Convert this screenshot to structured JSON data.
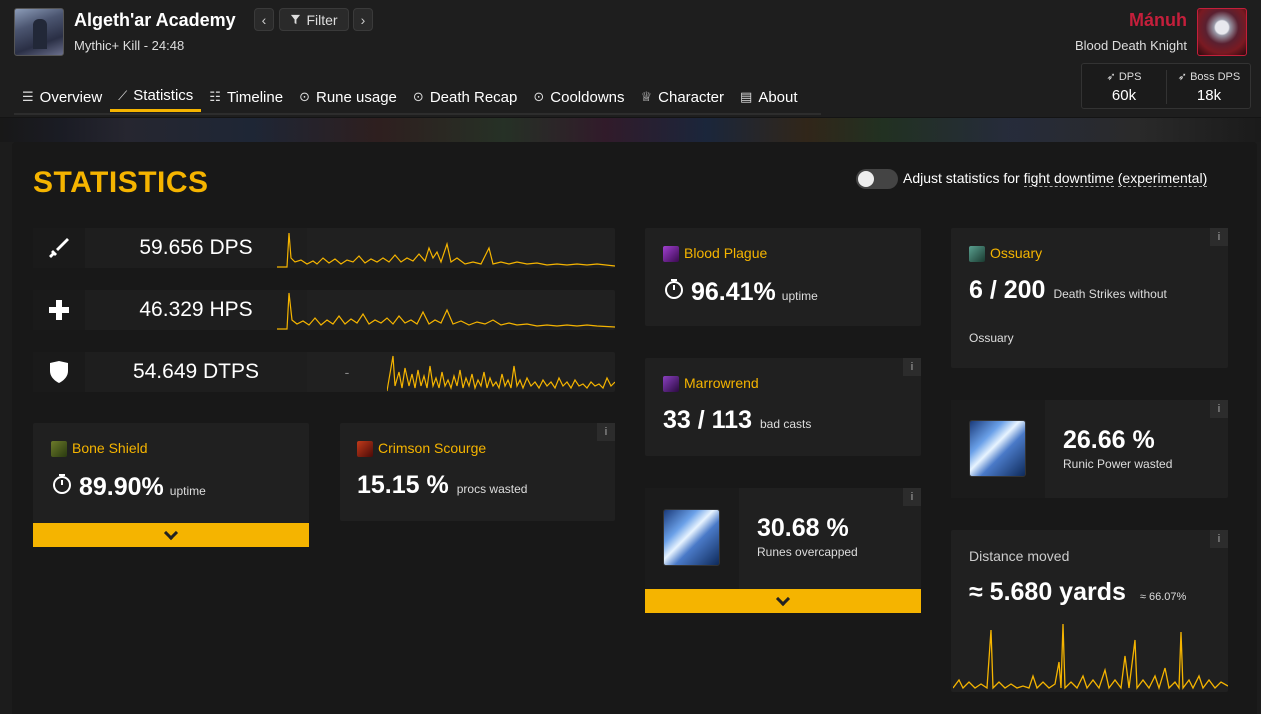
{
  "header": {
    "title": "Algeth'ar Academy",
    "subtitle": "Mythic+ Kill - 24:48",
    "filter_label": "Filter",
    "prev_label": "‹",
    "next_label": "›",
    "character": {
      "name": "Mánuh",
      "class": "Blood Death Knight"
    },
    "stats": [
      {
        "label": "DPS",
        "value": "60k"
      },
      {
        "label": "Boss DPS",
        "value": "18k"
      }
    ]
  },
  "tabs": [
    {
      "label": "Overview",
      "icon": "list-icon"
    },
    {
      "label": "Statistics",
      "icon": "chart-icon",
      "active": true
    },
    {
      "label": "Timeline",
      "icon": "timeline-icon"
    },
    {
      "label": "Rune usage",
      "icon": "circle-dots-icon"
    },
    {
      "label": "Death Recap",
      "icon": "circle-dots-icon"
    },
    {
      "label": "Cooldowns",
      "icon": "circle-dots-icon"
    },
    {
      "label": "Character",
      "icon": "shirt-icon"
    },
    {
      "label": "About",
      "icon": "document-icon"
    }
  ],
  "page": {
    "heading": "STATISTICS",
    "adjust_prefix": "Adjust statistics for",
    "adjust_link": "fight downtime",
    "adjust_suffix": "(experimental)",
    "adjust_enabled": false
  },
  "rows": [
    {
      "icon": "sword-icon",
      "value": "59.656 DPS"
    },
    {
      "icon": "plus-icon",
      "value": "46.329 HPS"
    },
    {
      "icon": "shield-icon",
      "value": "54.649 DTPS",
      "extra": "-"
    }
  ],
  "cards": {
    "bone_shield": {
      "name": "Bone Shield",
      "value": "89.90%",
      "label": "uptime"
    },
    "crimson_scourge": {
      "name": "Crimson Scourge",
      "value": "15.15 %",
      "label": "procs wasted",
      "info": "i"
    },
    "blood_plague": {
      "name": "Blood Plague",
      "value": "96.41%",
      "label": "uptime"
    },
    "marrowrend": {
      "name": "Marrowrend",
      "value": "33 / 113",
      "label": "bad casts",
      "info": "i"
    },
    "runes": {
      "value": "30.68 %",
      "label": "Runes overcapped",
      "info": "i"
    },
    "ossuary": {
      "name": "Ossuary",
      "value": "6 / 200",
      "label": "Death Strikes without",
      "label2": "Ossuary",
      "info": "i"
    },
    "runic_power": {
      "value": "26.66 %",
      "label": "Runic Power wasted",
      "info": "i"
    },
    "distance": {
      "title": "Distance moved",
      "value": "≈ 5.680 yards",
      "sub": "≈ 66.07%",
      "info": "i"
    }
  },
  "colors": {
    "accent": "#f5b400",
    "dk_red": "#c41f3b",
    "card": "#202020",
    "bg": "#181818"
  }
}
